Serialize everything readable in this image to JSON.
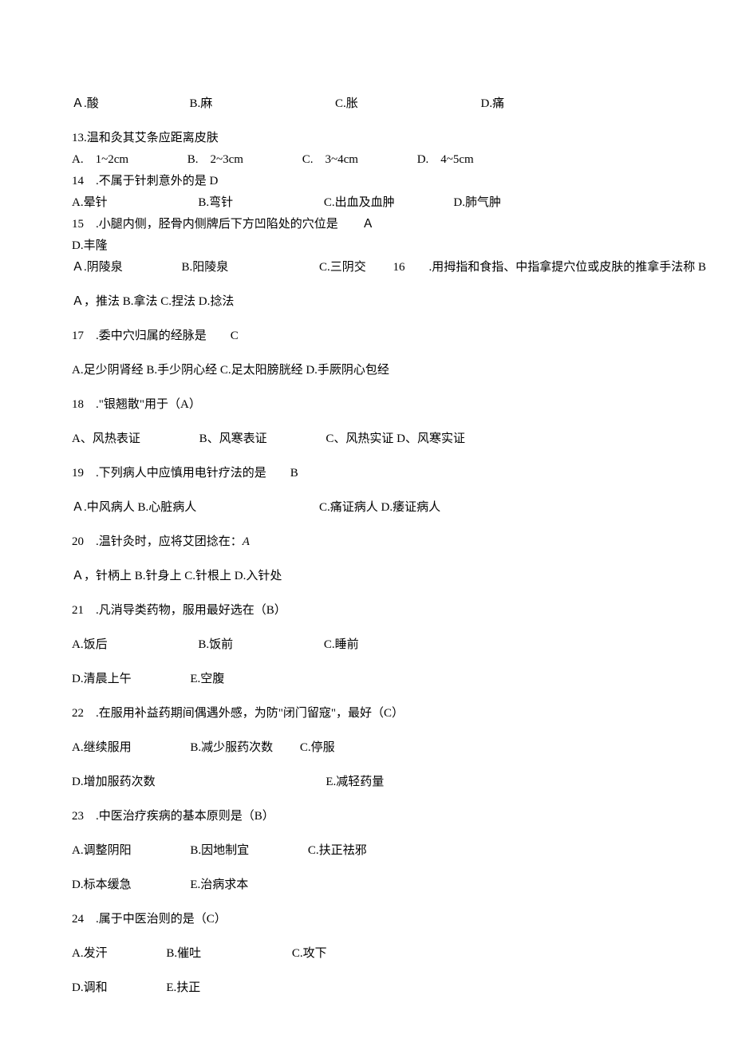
{
  "q12_opts": {
    "a": "Ａ.酸",
    "b": "B.麻",
    "c": "C.胀",
    "d": "D.痛"
  },
  "q13": {
    "stem": "13.温和灸其艾条应距离皮肤",
    "a": "A.　1~2cm",
    "b": "B.　2~3cm",
    "c": "C.　3~4cm",
    "d": "D.　4~5cm"
  },
  "q14": {
    "stem": "14　.不属于针刺意外的是 D",
    "a": "A.晕针",
    "b": "B.弯针",
    "c": "C.出血及血肿",
    "d": "D.肺气肿"
  },
  "q15": {
    "stem": "15　.小腿内侧，胫骨内侧牌后下方凹陷处的穴位是　　Ａ",
    "d_label": "D.丰隆",
    "a": "Ａ.阴陵泉",
    "b": "B.阳陵泉",
    "c": "C.三阴交",
    "q16_inline": "16　　.用拇指和食指、中指拿提穴位或皮肤的推拿手法称 B"
  },
  "q16_opts": "Ａ，推法 B.拿法 C.捏法 D.捻法",
  "q17": {
    "stem": "17　.委中穴归属的经脉是　　C",
    "opts": "A.足少阴肾经 B.手少阴心经 C.足太阳膀胱经 D.手厥阴心包经"
  },
  "q18": {
    "stem": "18　.\"银翘散\"用于（A）",
    "a": "A、风热表证",
    "b": "B、风寒表证",
    "c": "C、风热实证 D、风寒实证"
  },
  "q19": {
    "stem": "19　.下列病人中应慎用电针疗法的是　　B",
    "ab": "Ａ.中风病人 B.心脏病人",
    "cd": "C.痛证病人 D.痿证病人"
  },
  "q20": {
    "stem_prefix": "20　.温针灸时，应将艾团捻在：",
    "stem_italic": "A",
    "opts": "Ａ，针柄上 B.针身上 C.针根上 D.入针处"
  },
  "q21": {
    "stem": "21　.凡消导类药物，服用最好选在（B）",
    "a": "A.饭后",
    "b": "B.饭前",
    "c": "C.睡前",
    "d": "D.清晨上午",
    "e": "E.空腹"
  },
  "q22": {
    "stem": "22　.在服用补益药期间偶遇外感，为防\"闭门留寇\"，最好（C）",
    "a": "A.继续服用",
    "b": "B.减少服药次数",
    "c": "C.停服",
    "d": "D.增加服药次数",
    "e": "E.减轻药量"
  },
  "q23": {
    "stem": "23　.中医治疗疾病的基本原则是（B）",
    "a": "A.调整阴阳",
    "b": "B.因地制宜",
    "c": "C.扶正祛邪",
    "d": "D.标本缓急",
    "e": "E.治病求本"
  },
  "q24": {
    "stem": "24　.属于中医治则的是（C）",
    "a": "A.发汗",
    "b": "B.催吐",
    "c": "C.攻下",
    "d": "D.调和",
    "e": "E.扶正"
  }
}
